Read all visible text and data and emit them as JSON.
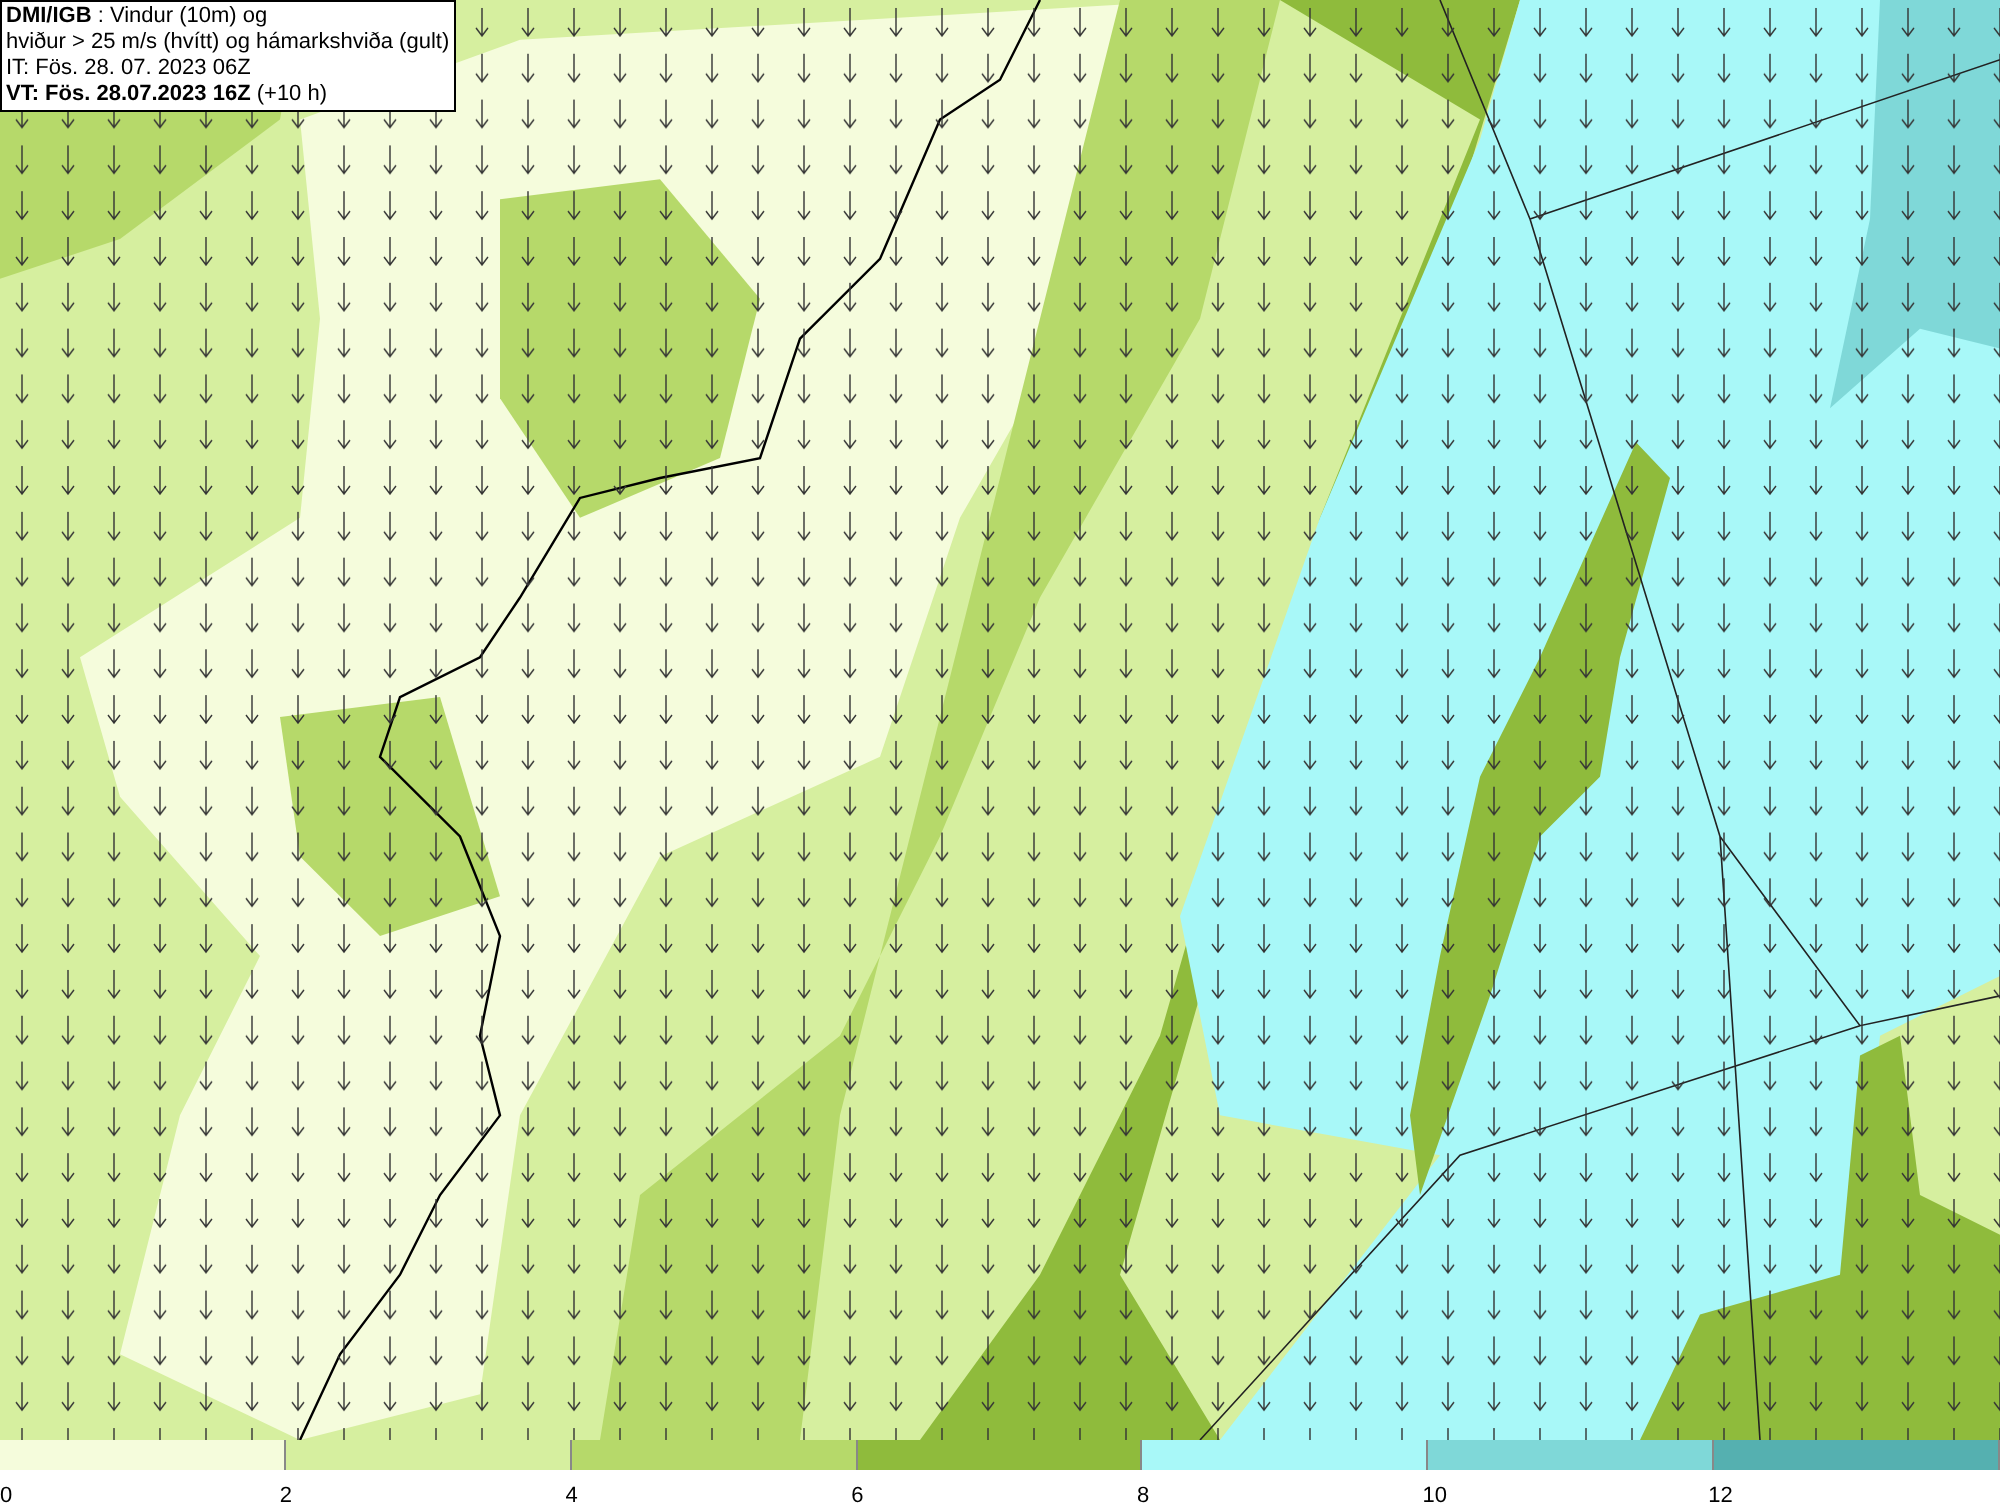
{
  "info_box": {
    "lines": [
      "**DMI/IGB** : Vindur (10m) og",
      "hviður > 25 m/s (hvítt) og hámarkshviða (gult)",
      "IT: Fös. 28. 07. 2023 06Z",
      "**VT: Fös. 28.07.2023 16Z** (+10 h)"
    ]
  },
  "legend": {
    "bins": [
      {
        "color": "#f5fcdc"
      },
      {
        "color": "#d6ef9f"
      },
      {
        "color": "#b6d96a"
      },
      {
        "color": "#8fbb3c"
      },
      {
        "color": "#a8f8f8"
      },
      {
        "color": "#7fd8d8"
      },
      {
        "color": "#55b0b0"
      }
    ],
    "labels": [
      "0",
      "2",
      "4",
      "6",
      "8",
      "10",
      "12"
    ]
  }
}
